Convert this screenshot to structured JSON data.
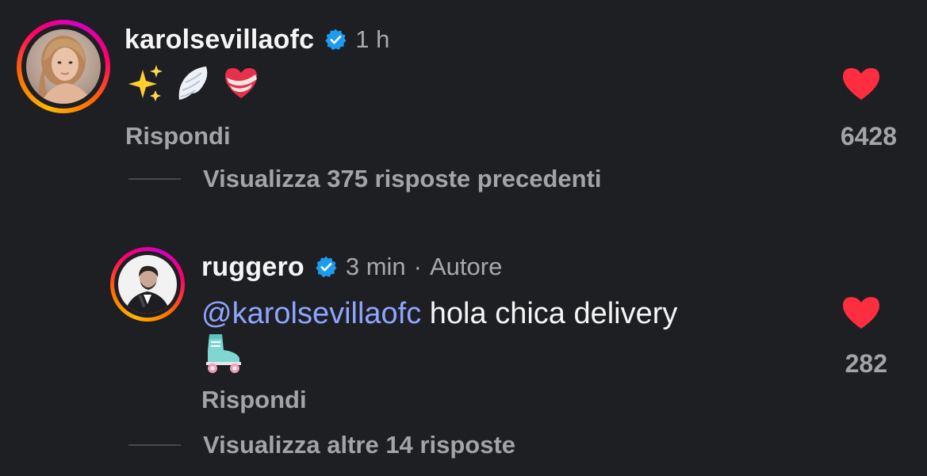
{
  "colors": {
    "background": "#1e1f23",
    "primary_text": "#f5f5f5",
    "secondary_text": "#a3a3a8",
    "mention": "#8fa5ff",
    "verified_badge": "#1d9bf0",
    "like_heart": "#ff2d40"
  },
  "comment": {
    "username": "karolsevillaofc",
    "time": "1 h",
    "emojis": [
      "sparkles-emoji",
      "wing-emoji",
      "mending-heart-emoji"
    ],
    "reply_label": "Rispondi",
    "like_count": "6428",
    "view_replies": "Visualizza 375 risposte precedenti"
  },
  "reply": {
    "username": "ruggero",
    "time": "3 min",
    "separator": "·",
    "author_badge": "Autore",
    "mention": "@karolsevillaofc",
    "text": " hola chica delivery",
    "emoji": "roller-skate-emoji",
    "reply_label": "Rispondi",
    "like_count": "282",
    "view_replies": "Visualizza altre 14 risposte"
  }
}
